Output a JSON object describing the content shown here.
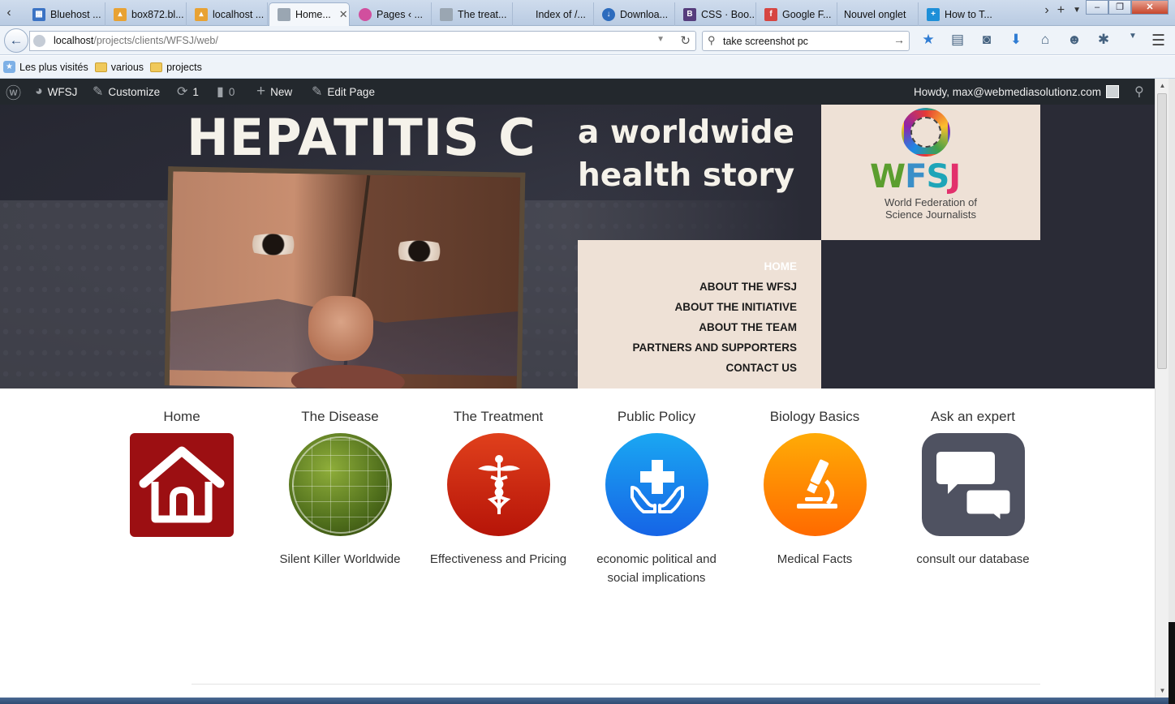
{
  "browser": {
    "tabs": [
      {
        "label": "Bluehost ...",
        "fav": "grid-icon",
        "color": "#3b73c4"
      },
      {
        "label": "box872.bl...",
        "fav": "pma-icon",
        "color": "#e8a233"
      },
      {
        "label": "localhost ...",
        "fav": "pma-icon",
        "color": "#e8a233"
      },
      {
        "label": "Home...",
        "fav": "page-icon",
        "color": "#9aa6b2",
        "active": true
      },
      {
        "label": "Pages ‹ ...",
        "fav": "wp-icon",
        "color": "#d14f9e"
      },
      {
        "label": "The treat...",
        "fav": "page-icon",
        "color": "#9aa6b2"
      },
      {
        "label": "Index of /...",
        "fav": "none",
        "color": "transparent"
      },
      {
        "label": "Downloa...",
        "fav": "download-icon",
        "color": "#2c6bbd"
      },
      {
        "label": "CSS · Boo...",
        "fav": "bootstrap-icon",
        "color": "#563d7c"
      },
      {
        "label": "Google F...",
        "fav": "google-fonts-icon",
        "color": "#d64541"
      },
      {
        "label": "Nouvel onglet",
        "fav": "none",
        "color": "transparent"
      },
      {
        "label": "How to T...",
        "fav": "plus-icon",
        "color": "#1d8fd8"
      }
    ],
    "close_glyph": "✕",
    "url_host": "localhost",
    "url_path": "/projects/clients/WFSJ/web/",
    "search_value": "take screenshot pc",
    "bookmarks": [
      {
        "label": "Les plus visités",
        "icon": "star-bookmark-icon"
      },
      {
        "label": "various",
        "icon": "folder-icon"
      },
      {
        "label": "projects",
        "icon": "folder-icon"
      }
    ]
  },
  "adminbar": {
    "site": "WFSJ",
    "customize": "Customize",
    "updates_count": "1",
    "comments_count": "0",
    "new": "New",
    "edit_page": "Edit Page",
    "howdy": "Howdy, max@webmediasolutionz.com"
  },
  "hero": {
    "title": "HEPATITIS C",
    "subtitle_line1": "a worldwide",
    "subtitle_line2": "health story",
    "logo_letters": [
      "W",
      "F",
      "S",
      "J"
    ],
    "logo_line1": "World Federation of",
    "logo_line2": "Science Journalists",
    "menu": [
      "HOME",
      "ABOUT THE WFSJ",
      "ABOUT THE INITIATIVE",
      "ABOUT THE TEAM",
      "PARTNERS AND SUPPORTERS",
      "CONTACT US"
    ]
  },
  "features": [
    {
      "title": "Home",
      "desc": "",
      "icon": "house-icon"
    },
    {
      "title": "The Disease",
      "desc": "Silent Killer Worldwide",
      "icon": "globe-icon"
    },
    {
      "title": "The Treatment",
      "desc": "Effectiveness and Pricing",
      "icon": "caduceus-icon"
    },
    {
      "title": "Public Policy",
      "desc": "economic political and social implications",
      "icon": "hands-cross-icon"
    },
    {
      "title": "Biology Basics",
      "desc": "Medical Facts",
      "icon": "microscope-icon"
    },
    {
      "title": "Ask an expert",
      "desc": "consult our database",
      "icon": "chat-bubbles-icon"
    }
  ]
}
